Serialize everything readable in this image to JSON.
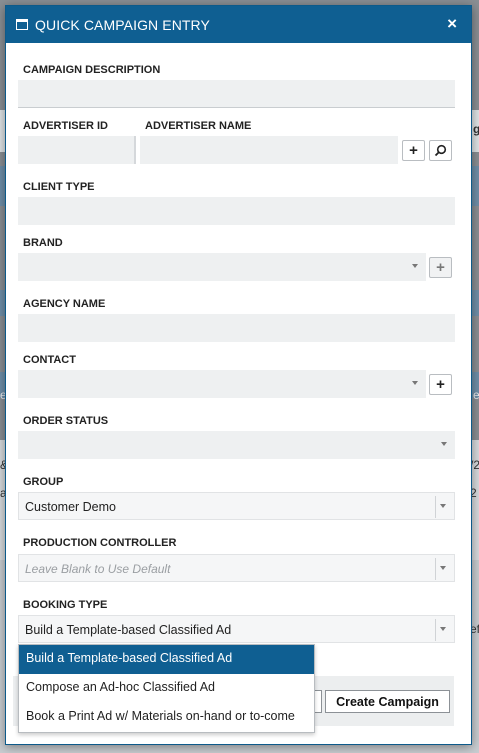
{
  "dialog": {
    "title": "QUICK CAMPAIGN ENTRY",
    "close_glyph": "×"
  },
  "fields": {
    "campaign_description": {
      "label": "CAMPAIGN DESCRIPTION",
      "value": ""
    },
    "advertiser_id": {
      "label": "ADVERTISER ID",
      "value": ""
    },
    "advertiser_name": {
      "label": "ADVERTISER NAME",
      "value": "",
      "add_glyph": "+",
      "search_icon": "search-icon"
    },
    "client_type": {
      "label": "CLIENT TYPE",
      "value": ""
    },
    "brand": {
      "label": "BRAND",
      "value": "",
      "add_glyph": "+"
    },
    "agency_name": {
      "label": "AGENCY NAME",
      "value": ""
    },
    "contact": {
      "label": "CONTACT",
      "value": "",
      "add_glyph": "+"
    },
    "order_status": {
      "label": "ORDER STATUS",
      "value": ""
    },
    "group": {
      "label": "GROUP",
      "value": "Customer Demo"
    },
    "production_controller": {
      "label": "PRODUCTION CONTROLLER",
      "placeholder": "Leave Blank to Use Default"
    },
    "booking_type": {
      "label": "BOOKING TYPE",
      "value": "Build a Template-based Classified Ad",
      "options": [
        "Build a Template-based Classified Ad",
        "Compose an Ad-hoc Classified Ad",
        "Book a Print Ad w/ Materials on-hand or to-come"
      ],
      "selected_index": 0
    }
  },
  "footer": {
    "create_label": "Create Campaign"
  },
  "background": {
    "letters": [
      "g",
      "e",
      "e",
      "&",
      "2",
      "a",
      "/2",
      "ef"
    ]
  },
  "colors": {
    "accent": "#0f5f92",
    "field_bg": "#eef0f1"
  }
}
